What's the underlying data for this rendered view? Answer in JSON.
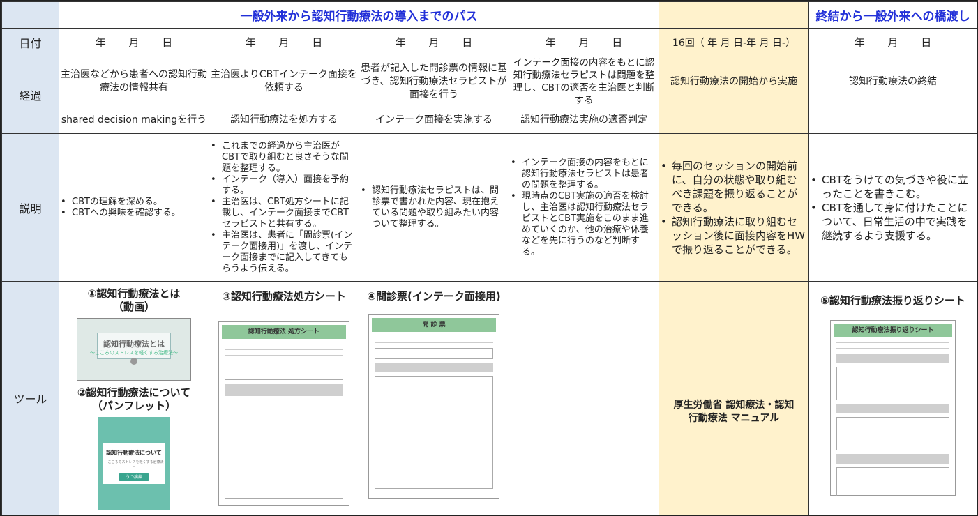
{
  "header": {
    "path_title": "一般外来から認知行動療法の導入までのパス",
    "bridge_title": "終結から一般外来への橋渡し"
  },
  "rows": {
    "date": "日付",
    "progress": "経過",
    "explanation": "説明",
    "tools": "ツール"
  },
  "dates": [
    "年 月 日",
    "年 月 日",
    "年 月 日",
    "年 月 日",
    "16回（ 年 月 日-年 月 日-）",
    "年 月 日"
  ],
  "progress_top": [
    "主治医などから患者への認知行動療法の情報共有",
    "主治医よりCBTインテーク面接を依頼する",
    "患者が記入した問診票の情報に基づき、認知行動療法セラピストが面接を行う",
    "インテーク面接の内容をもとに認知行動療法セラピストは問題を整理し、CBTの適否を主治医と判断する",
    "認知行動療法の開始から実施",
    "認知行動療法の終結"
  ],
  "progress_bottom": [
    "shared decision makingを行う",
    "認知行動療法を処方する",
    "インテーク面接を実施する",
    "認知行動療法実施の適否判定",
    "",
    ""
  ],
  "explanations": {
    "col1": [
      "CBTの理解を深める。",
      "CBTへの興味を確認する。"
    ],
    "col2": [
      "これまでの経過から主治医がCBTで取り組むと良さそうな問題を整理する。",
      "インテーク（導入）面接を予約する。",
      "主治医は、CBT処方シートに記載し、インテーク面接までCBTセラピストと共有する。",
      "主治医は、患者に「問診票(インテーク面接用)」を渡し、インテーク面接までに記入してきてもらうよう伝える。"
    ],
    "col3": [
      "認知行動療法セラピストは、問診票で書かれた内容、現在抱えている問題や取り組みたい内容ついて整理する。"
    ],
    "col4": [
      "インテーク面接の内容をもとに認知行動療法セラピストは患者の問題を整理する。",
      "現時点のCBT実施の適否を検討し、主治医は認知行動療法セラピストとCBT実施をこのまま進めていくのか、他の治療や休養などを先に行うのなど判断する。"
    ],
    "col5": [
      "毎回のセッションの開始前に、自分の状態や取り組むべき課題を振り返ることができる。",
      "認知行動療法に取り組むセッション後に面接内容をHWで振り返ることができる。"
    ],
    "col6": [
      "CBTをうけての気づきや役に立ったことを書きこむ。",
      "CBTを通して身に付けたことについて、日常生活の中で実践を継続するよう支援する。"
    ]
  },
  "tools": {
    "t1_title": "①認知行動療法とは（動画）",
    "t1_video_title": "認知行動療法とは",
    "t1_video_sub": "～こころのストレスを軽くする治療法～",
    "t2_title": "②認知行動療法について（パンフレット）",
    "t2_pamph_title": "認知行動療法について",
    "t2_pamph_sub": "－こころのストレスを軽くする治療法－",
    "t2_pamph_badge": "うつ病編",
    "t3_title": "③認知行動療法処方シート",
    "t3_sheet_title": "認知行動療法 処方シート",
    "t4_title": "④問診票(インテーク面接用)",
    "t4_sheet_title": "問 診 票",
    "t5_manual": "厚生労働省 認知療法・認知行動療法 マニュアル",
    "t6_title": "⑤認知行動療法振り返りシート",
    "t6_sheet_title": "認知行動療法振り返りシート"
  },
  "colors": {
    "rowhead_bg": "#dce6f2",
    "highlight_bg": "#fff2cc",
    "title_blue": "#2230d8",
    "sheet_green": "#8fc79a",
    "pamphlet_teal": "#6cc0ae"
  }
}
